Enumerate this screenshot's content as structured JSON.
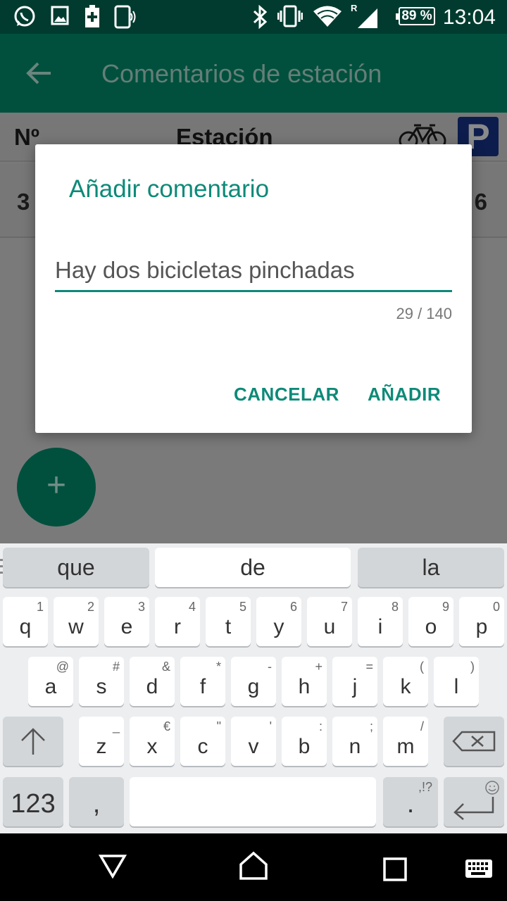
{
  "status_bar": {
    "time": "13:04",
    "battery": "89 %",
    "roaming": "R",
    "icons": [
      "whatsapp-icon",
      "image-icon",
      "battery-saver-icon",
      "nfc-phone-icon",
      "bluetooth-icon",
      "vibrate-icon",
      "wifi-icon",
      "signal-icon"
    ]
  },
  "toolbar": {
    "title": "Comentarios de estación"
  },
  "table": {
    "headers": {
      "number": "Nº",
      "station": "Estación"
    },
    "row": {
      "number": "3",
      "count": "6"
    }
  },
  "dialog": {
    "title": "Añadir comentario",
    "input_value": "Hay dos bicicletas pinchadas",
    "counter": "29 / 140",
    "cancel_label": "CANCELAR",
    "add_label": "AÑADIR"
  },
  "fab": {
    "icon": "+"
  },
  "keyboard": {
    "suggestions": [
      "que",
      "de",
      "la"
    ],
    "row1": [
      {
        "k": "q",
        "s": "1"
      },
      {
        "k": "w",
        "s": "2"
      },
      {
        "k": "e",
        "s": "3"
      },
      {
        "k": "r",
        "s": "4"
      },
      {
        "k": "t",
        "s": "5"
      },
      {
        "k": "y",
        "s": "6"
      },
      {
        "k": "u",
        "s": "7"
      },
      {
        "k": "i",
        "s": "8"
      },
      {
        "k": "o",
        "s": "9"
      },
      {
        "k": "p",
        "s": "0"
      }
    ],
    "row2": [
      {
        "k": "a",
        "s": "@"
      },
      {
        "k": "s",
        "s": "#"
      },
      {
        "k": "d",
        "s": "&"
      },
      {
        "k": "f",
        "s": "*"
      },
      {
        "k": "g",
        "s": "-"
      },
      {
        "k": "h",
        "s": "+"
      },
      {
        "k": "j",
        "s": "="
      },
      {
        "k": "k",
        "s": "("
      },
      {
        "k": "l",
        "s": ")"
      }
    ],
    "row3": [
      {
        "k": "z",
        "s": "_"
      },
      {
        "k": "x",
        "s": "€"
      },
      {
        "k": "c",
        "s": "\""
      },
      {
        "k": "v",
        "s": "'"
      },
      {
        "k": "b",
        "s": ":"
      },
      {
        "k": "n",
        "s": ";"
      },
      {
        "k": "m",
        "s": "/"
      }
    ],
    "numbers_label": "123",
    "comma_label": ",",
    "period_label": ".",
    "period_sub": ",!?"
  }
}
